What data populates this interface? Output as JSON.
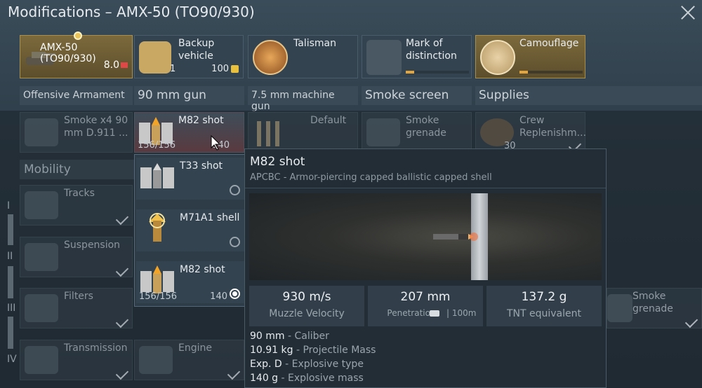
{
  "window": {
    "title": "Modifications – AMX-50 (TO90/930)"
  },
  "topcards": {
    "vehicle": {
      "name": "AMX-50 (TO90/930)",
      "rating": "8.0"
    },
    "backup": {
      "label_line1": "Backup",
      "label_line2": "vehicle",
      "count": "1",
      "price": "100"
    },
    "talisman": {
      "label": "Talisman"
    },
    "mark": {
      "label_line1": "Mark of",
      "label_line2": "distinction"
    },
    "camo": {
      "label": "Camouflage"
    }
  },
  "categories": [
    "Offensive Armament",
    "90 mm gun",
    "7.5 mm machine gun",
    "Smoke screen",
    "Supplies"
  ],
  "row1": {
    "smoke": {
      "line1": "Smoke x4 90",
      "line2": "mm D.911 ..."
    },
    "mg": {
      "label": "Default"
    },
    "smokegren": {
      "line1": "Smoke",
      "line2": "grenade"
    },
    "crew": {
      "line1": "Crew",
      "line2": "Replenishm...",
      "count": "30"
    }
  },
  "mobility": {
    "header": "Mobility",
    "tracks": "Tracks",
    "suspension": "Suspension",
    "filters": "Filters",
    "transmission": "Transmission",
    "engine": "Engine"
  },
  "tiers": [
    "I",
    "II",
    "III",
    "IV"
  ],
  "right_slot": {
    "line1": "Smoke",
    "line2": "grenade"
  },
  "ammo": {
    "selected": {
      "name": "M82 shot",
      "count": "156/156",
      "count2": "140"
    },
    "options": [
      {
        "name": "T33 shot"
      },
      {
        "name": "M71A1 shell"
      },
      {
        "name": "M82 shot",
        "count": "156/156",
        "count2": "140"
      }
    ]
  },
  "tooltip": {
    "title": "M82 shot",
    "subtitle": "APCBC - Armor-piercing capped ballistic capped shell",
    "stats": [
      {
        "value": "930 m/s",
        "caption": "Muzzle Velocity"
      },
      {
        "value": "207 mm",
        "caption": "Penetration",
        "caption2": "| 100m"
      },
      {
        "value": "137.2 g",
        "caption": "TNT equivalent"
      }
    ],
    "details": [
      {
        "key": "90 mm",
        "desc": " - Caliber"
      },
      {
        "key": "10.91 kg",
        "desc": " - Projectile Mass"
      },
      {
        "key": "Exp. D",
        "desc": " - Explosive type"
      },
      {
        "key": "140 g",
        "desc": " - Explosive mass"
      }
    ]
  },
  "colors": {
    "accent": "#e4a63c",
    "gold": "#a88f4e"
  }
}
